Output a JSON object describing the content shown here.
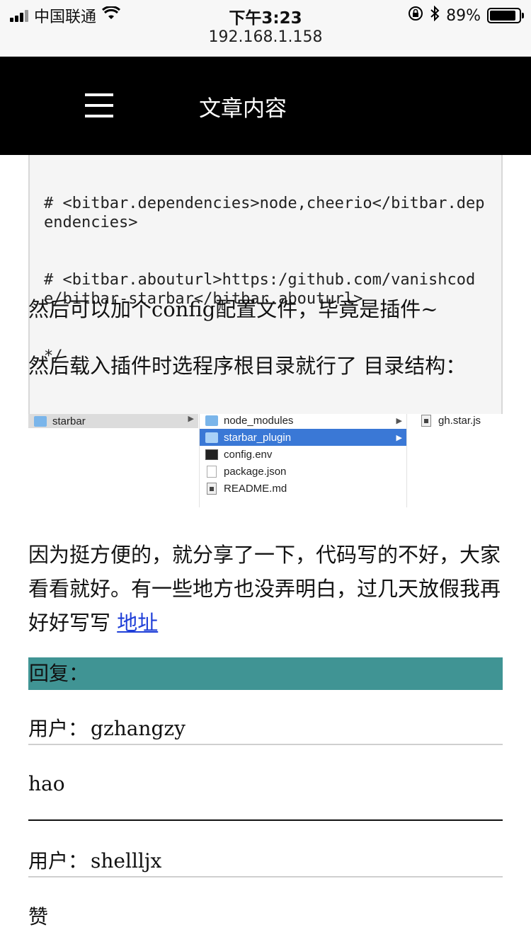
{
  "status_bar": {
    "carrier": "中国联通",
    "time": "下午3:23",
    "battery": "89%",
    "battery_level": 0.89,
    "url": "192.168.1.158",
    "icons": [
      "signal-icon",
      "wifi-icon",
      "orientation-lock-icon",
      "bluetooth-icon",
      "battery-icon"
    ]
  },
  "header": {
    "title": "文章内容",
    "menu_icon": "hamburger-menu-icon"
  },
  "article": {
    "code_lines": [
      "# <bitbar.dependencies>node,cheerio</bitbar.dependencies>",
      "# <bitbar.abouturl>https:/github.com/vanishcode/bitbar-starbar</bitbar.abouturl>",
      "*/"
    ],
    "para1": "然后可以加个config配置文件，毕竟是插件~",
    "para2": "然后载入插件时选程序根目录就行了 目录结构：",
    "finder": {
      "col1": "starbar",
      "col2": [
        "node_modules",
        "starbar_plugin",
        "config.env",
        "package.json",
        "README.md"
      ],
      "selected": "starbar_plugin",
      "col3": "gh.star.js"
    },
    "para3_text": "因为挺方便的，就分享了一下，代码写的不好，大家看看就好。有一些地方也没弄明白，过几天放假我再好好写写 ",
    "link_label": "地址"
  },
  "replies": {
    "heading": "回复：",
    "user_prefix": "用户：",
    "items": [
      {
        "user": "gzhangzy",
        "comment": "hao"
      },
      {
        "user": "shellljx",
        "comment": "赞"
      }
    ]
  }
}
